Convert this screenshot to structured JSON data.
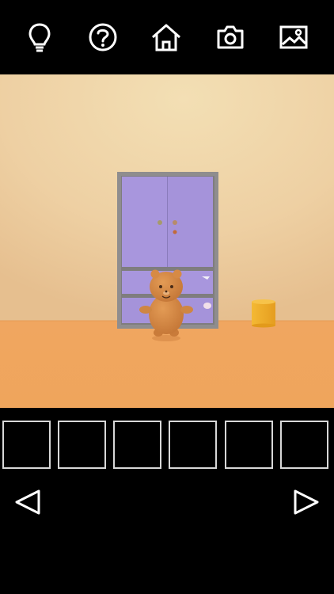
{
  "toolbar": {
    "buttons": [
      {
        "name": "hint",
        "icon": "lightbulb-icon"
      },
      {
        "name": "help",
        "icon": "question-circle-icon"
      },
      {
        "name": "home",
        "icon": "home-icon"
      },
      {
        "name": "camera",
        "icon": "camera-icon"
      },
      {
        "name": "photos",
        "icon": "picture-icon"
      }
    ]
  },
  "scene": {
    "description_colors": {
      "wall": "#f1d8a7",
      "floor": "#f0a55c",
      "cabinet_frame": "#8c8c8c",
      "cabinet_doors": "#a897dc",
      "bear": "#d68a45",
      "bucket": "#f2b02c"
    }
  },
  "inventory": {
    "slot_count": 6
  },
  "navigation": {
    "left": "left-arrow-icon",
    "right": "right-arrow-icon"
  }
}
